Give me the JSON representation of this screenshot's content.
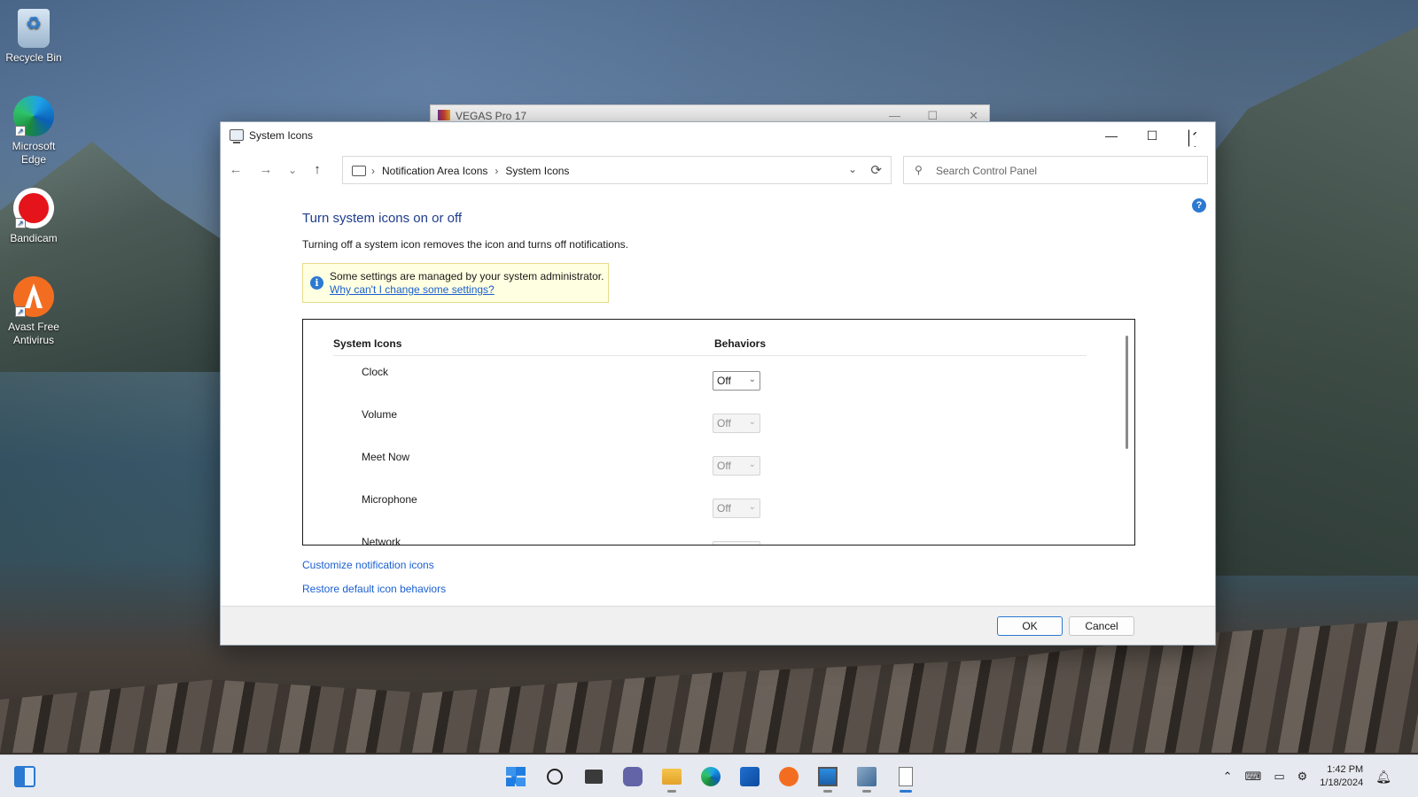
{
  "desktop": {
    "icons": [
      {
        "label": "Recycle Bin",
        "icon": "recycle-bin-icon"
      },
      {
        "label": "Microsoft Edge",
        "icon": "edge-icon"
      },
      {
        "label": "Bandicam",
        "icon": "bandicam-icon"
      },
      {
        "label": "Avast Free Antivirus",
        "icon": "avast-icon"
      }
    ]
  },
  "background_window": {
    "title": "VEGAS Pro 17"
  },
  "window": {
    "title": "System Icons",
    "controls": {
      "minimize": "—",
      "maximize": "☐",
      "close": "✕"
    }
  },
  "navigation": {
    "back": "←",
    "forward": "→",
    "recent": "⌄",
    "up": "↑",
    "breadcrumbs": [
      "Notification Area Icons",
      "System Icons"
    ],
    "refresh": "⟳",
    "search_placeholder": "Search Control Panel"
  },
  "content": {
    "heading": "Turn system icons on or off",
    "description": "Turning off a system icon removes the icon and turns off notifications.",
    "info": {
      "text": "Some settings are managed by your system administrator.",
      "link": "Why can't I change some settings?"
    },
    "table": {
      "columns": [
        "System Icons",
        "Behaviors"
      ],
      "rows": [
        {
          "name": "Clock",
          "behavior": "Off",
          "enabled": true
        },
        {
          "name": "Volume",
          "behavior": "Off",
          "enabled": false
        },
        {
          "name": "Meet Now",
          "behavior": "Off",
          "enabled": false
        },
        {
          "name": "Microphone",
          "behavior": "Off",
          "enabled": false
        },
        {
          "name": "Network",
          "behavior": "",
          "enabled": false
        }
      ]
    },
    "links": [
      "Customize notification icons",
      "Restore default icon behaviors"
    ]
  },
  "footer": {
    "ok": "OK",
    "cancel": "Cancel"
  },
  "taskbar": {
    "apps": [
      "start",
      "search",
      "task-view",
      "chat",
      "file-explorer",
      "edge",
      "store",
      "avast",
      "this-pc",
      "network-app",
      "document-app"
    ],
    "time": "1:42 PM",
    "date": "1/18/2024"
  },
  "colors": {
    "heading": "#1e3c8c",
    "link": "#1a5fd1",
    "accent": "#2b79d1",
    "info_bg": "#ffffe1"
  }
}
